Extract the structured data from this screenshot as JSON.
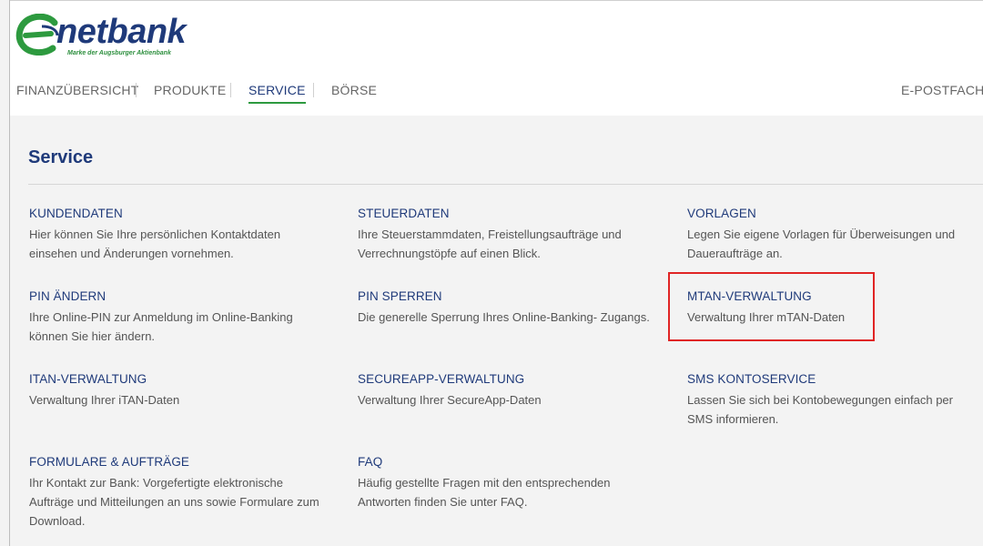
{
  "brand": {
    "wordmark": "netbank",
    "tagline": "Marke der Augsburger Aktienbank",
    "colors": {
      "blue": "#1f3a7a",
      "green": "#2d9a3f"
    }
  },
  "nav": {
    "items": [
      {
        "label": "FINANZÜBERSICHT"
      },
      {
        "label": "PRODUKTE"
      },
      {
        "label": "SERVICE",
        "active": true
      },
      {
        "label": "BÖRSE"
      }
    ],
    "right_item": "E-POSTFACH"
  },
  "page": {
    "title": "Service"
  },
  "services": [
    {
      "title": "KUNDENDATEN",
      "desc": "Hier können Sie Ihre persönlichen Kontaktdaten einsehen und Änderungen vornehmen."
    },
    {
      "title": "STEUERDATEN",
      "desc": "Ihre Steuerstammdaten, Freistellungsaufträge und Verrechnungstöpfe auf einen Blick."
    },
    {
      "title": "VORLAGEN",
      "desc": "Legen Sie eigene Vorlagen für Überweisungen und Daueraufträge an."
    },
    {
      "title": "PIN ÄNDERN",
      "desc": "Ihre Online-PIN zur Anmeldung im Online-Banking können Sie hier ändern."
    },
    {
      "title": "PIN SPERREN",
      "desc": "Die generelle Sperrung Ihres Online-Banking- Zugangs."
    },
    {
      "title": "MTAN-VERWALTUNG",
      "desc": "Verwaltung Ihrer mTAN-Daten"
    },
    {
      "title": "ITAN-VERWALTUNG",
      "desc": "Verwaltung Ihrer iTAN-Daten"
    },
    {
      "title": "SECUREAPP-VERWALTUNG",
      "desc": "Verwaltung Ihrer SecureApp-Daten"
    },
    {
      "title": "SMS KONTOSERVICE",
      "desc": "Lassen Sie sich bei Kontobewegungen einfach per SMS informieren."
    },
    {
      "title": "FORMULARE & AUFTRÄGE",
      "desc": "Ihr Kontakt zur Bank: Vorgefertigte elektronische Aufträge und Mitteilungen an uns sowie Formulare zum Download."
    },
    {
      "title": "FAQ",
      "desc": "Häufig gestellte Fragen mit den entsprechenden Antworten finden Sie unter FAQ."
    }
  ],
  "highlight_color": "#e02424"
}
